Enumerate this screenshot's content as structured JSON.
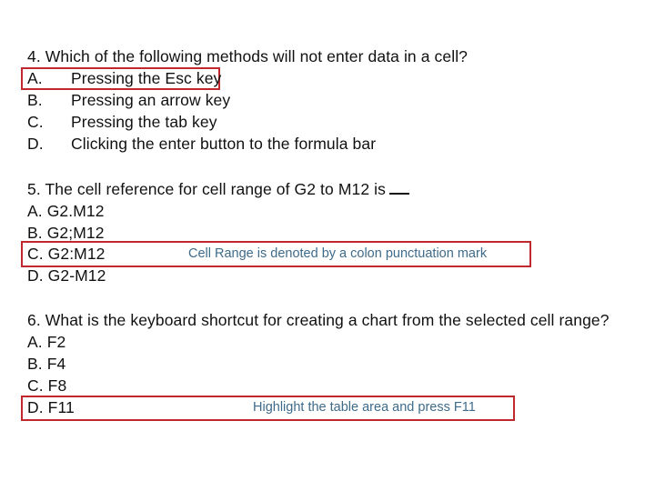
{
  "q4": {
    "question": "4. Which of the following methods will not enter data in a cell?",
    "options": [
      {
        "letter": "A.",
        "text": "Pressing the Esc key"
      },
      {
        "letter": "B.",
        "text": "Pressing an arrow key"
      },
      {
        "letter": "C.",
        "text": "Pressing the tab key"
      },
      {
        "letter": "D.",
        "text": "Clicking the enter button to the formula bar"
      }
    ],
    "highlighted_answer": "A"
  },
  "q5": {
    "question": "5. The cell reference for cell range of G2 to M12 is",
    "options": [
      {
        "text": "A. G2.M12"
      },
      {
        "text": "B. G2;M12"
      },
      {
        "text": "C. G2:M12"
      },
      {
        "text": "D. G2-M12"
      }
    ],
    "highlighted_answer": "C",
    "note": "Cell Range is denoted by a colon punctuation mark"
  },
  "q6": {
    "question": "6. What is the keyboard shortcut for creating a chart from the selected cell range?",
    "options": [
      {
        "text": "A. F2"
      },
      {
        "text": "B. F4"
      },
      {
        "text": "C. F8"
      },
      {
        "text": "D. F11"
      }
    ],
    "highlighted_answer": "D",
    "note": "Highlight the table area and press F11"
  },
  "colors": {
    "highlight_border": "#c0282e",
    "note_text": "#3f6b8a"
  }
}
